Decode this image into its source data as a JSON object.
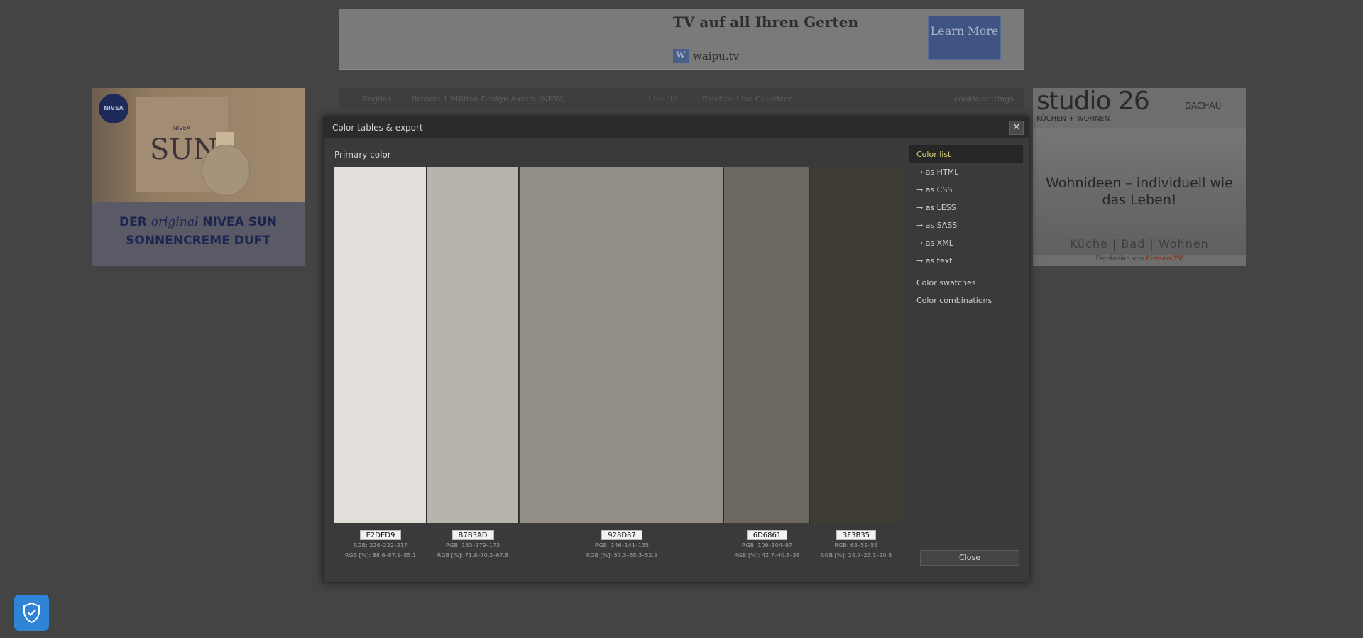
{
  "top_ad": {
    "headline": "TV auf all Ihren Gerten",
    "brand_logo": "W",
    "brand": "waipu.tv",
    "button": "Learn More"
  },
  "nav": {
    "language": "English",
    "browse": "Browse 1 Million Design Assets (NEW)",
    "like": "Like it?",
    "palettes": "Palettes Live Colorizer",
    "cookie": "cookie settings"
  },
  "ad_left": {
    "badge": "NIVEA",
    "small": "NIVEA",
    "big": "SUN",
    "slogan_line1_a": "DER ",
    "slogan_line1_b": "original",
    "slogan_line1_c": " NIVEA SUN",
    "slogan_line2": "SONNENCREME DUFT"
  },
  "ad_right": {
    "logo": "studio 26",
    "logo_sub": "KÜCHEN + WOHNEN",
    "city": "DACHAU",
    "tagline": "Wohnideen – individuell wie das Leben!",
    "sub": "Küche | Bad | Wohnen",
    "credit_prefix": "Empfohlen von ",
    "credit_brand": "Firmen.TV"
  },
  "modal": {
    "title": "Color tables & export",
    "close_icon": "close-x-icon",
    "section_title": "Primary color",
    "close_button": "Close"
  },
  "swatches": [
    {
      "hex": "E2DED9",
      "color": "#E2DED9",
      "rgb": "RGB: 226–222–217",
      "rgb_pct": "RGB [%]: 88.6–87.1–85.1"
    },
    {
      "hex": "B7B3AD",
      "color": "#B7B3AD",
      "rgb": "RGB: 183–179–173",
      "rgb_pct": "RGB [%]: 71.8–70.2–67.8"
    },
    {
      "hex": "928D87",
      "color": "#928D87",
      "rgb": "RGB: 146–141–135",
      "rgb_pct": "RGB [%]: 57.3–55.3–52.9"
    },
    {
      "hex": "6D6861",
      "color": "#6D6861",
      "rgb": "RGB: 109–104–97",
      "rgb_pct": "RGB [%]: 42.7–40.8–38"
    },
    {
      "hex": "3F3B35",
      "color": "#3F3B35",
      "rgb": "RGB: 63–59–53",
      "rgb_pct": "RGB [%]: 24.7–23.1–20.8"
    }
  ],
  "sidebar": {
    "items": [
      {
        "label": "Color list",
        "active": true
      },
      {
        "label": "→ as HTML"
      },
      {
        "label": "→ as CSS"
      },
      {
        "label": "→ as LESS"
      },
      {
        "label": "→ as SASS"
      },
      {
        "label": "→ as XML"
      },
      {
        "label": "→ as text"
      },
      {
        "label": "Color swatches"
      },
      {
        "label": "Color combinations"
      }
    ]
  },
  "privacy": {
    "icon": "shield-check-icon"
  }
}
